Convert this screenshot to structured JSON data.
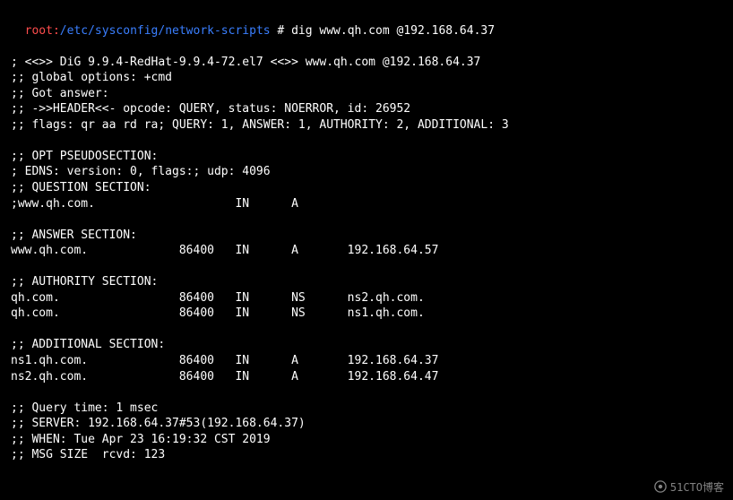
{
  "prompt": {
    "user": "root",
    "sep": ":",
    "path": "/etc/sysconfig/network-scripts",
    "hash": " # ",
    "command": "dig www.qh.com @192.168.64.37"
  },
  "header": {
    "banner": "; <<>> DiG 9.9.4-RedHat-9.9.4-72.el7 <<>> www.qh.com @192.168.64.37",
    "global_options": ";; global options: +cmd",
    "got_answer": ";; Got answer:",
    "header_line": ";; ->>HEADER<<- opcode: QUERY, status: NOERROR, id: 26952",
    "flags": ";; flags: qr aa rd ra; QUERY: 1, ANSWER: 1, AUTHORITY: 2, ADDITIONAL: 3"
  },
  "opt": {
    "title": ";; OPT PSEUDOSECTION:",
    "edns": "; EDNS: version: 0, flags:; udp: 4096"
  },
  "question": {
    "title": ";; QUESTION SECTION:",
    "row": ";www.qh.com.                    IN      A"
  },
  "answer": {
    "title": ";; ANSWER SECTION:",
    "row": "www.qh.com.             86400   IN      A       192.168.64.57"
  },
  "authority": {
    "title": ";; AUTHORITY SECTION:",
    "row1": "qh.com.                 86400   IN      NS      ns2.qh.com.",
    "row2": "qh.com.                 86400   IN      NS      ns1.qh.com."
  },
  "additional": {
    "title": ";; ADDITIONAL SECTION:",
    "row1": "ns1.qh.com.             86400   IN      A       192.168.64.37",
    "row2": "ns2.qh.com.             86400   IN      A       192.168.64.47"
  },
  "footer": {
    "query_time": ";; Query time: 1 msec",
    "server": ";; SERVER: 192.168.64.37#53(192.168.64.37)",
    "when": ";; WHEN: Tue Apr 23 16:19:32 CST 2019",
    "msg_size": ";; MSG SIZE  rcvd: 123"
  },
  "watermark": "51CTO博客"
}
